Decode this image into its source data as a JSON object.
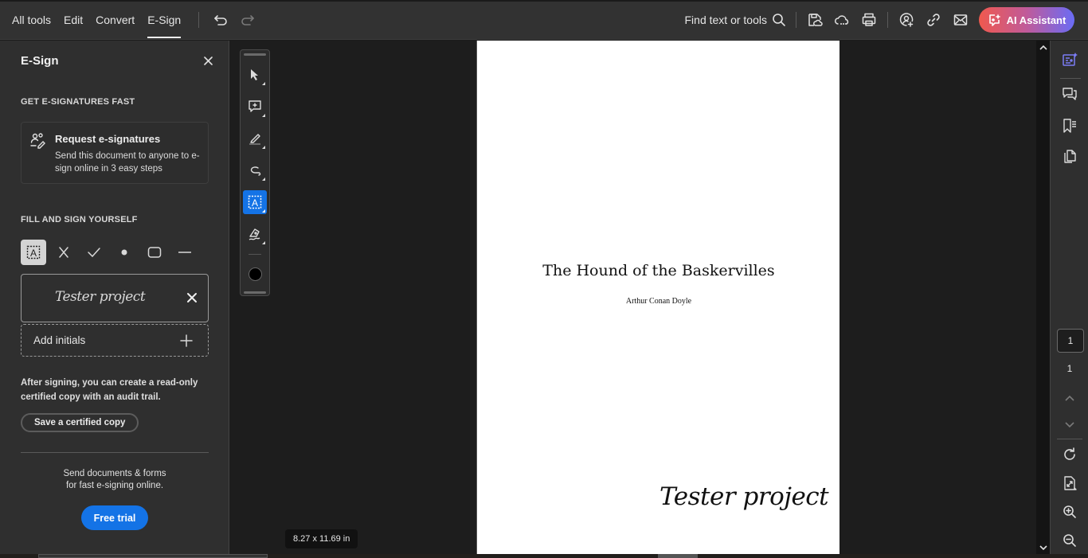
{
  "topbar": {
    "nav": [
      {
        "label": "All tools",
        "active": false
      },
      {
        "label": "Edit",
        "active": false
      },
      {
        "label": "Convert",
        "active": false
      },
      {
        "label": "E-Sign",
        "active": true
      }
    ],
    "find_label": "Find text or tools",
    "ai_assistant_label": "AI Assistant",
    "icons": [
      "undo-icon",
      "redo-icon",
      "search-icon",
      "save-icon",
      "cloud-icon",
      "print-icon",
      "share-user-icon",
      "link-icon",
      "email-icon"
    ]
  },
  "panel": {
    "title": "E-Sign",
    "section1_heading": "GET E-SIGNATURES FAST",
    "request": {
      "title": "Request e-signatures",
      "description": "Send this document to anyone to e-sign online in 3 easy steps"
    },
    "section2_heading": "FILL AND SIGN YOURSELF",
    "tools": [
      "text-field",
      "cross-mark",
      "check-mark",
      "dot",
      "rectangle",
      "line"
    ],
    "signature_text": "Tester project",
    "add_initials_label": "Add initials",
    "after_signing_text": "After signing, you can create a read-only certified copy with an audit trail.",
    "certified_copy_label": "Save a certified copy",
    "promo_line1": "Send documents & forms",
    "promo_line2": "for fast e-signing online.",
    "free_trial_label": "Free trial"
  },
  "document": {
    "title": "The Hound of the Baskervilles",
    "author": "Arthur Conan Doyle",
    "placed_signature": "Tester project",
    "page_size": "8.27 x 11.69 in"
  },
  "rightbar": {
    "current_page": "1",
    "total_pages": "1"
  },
  "colors": {
    "accent": "#1473e6",
    "ai_gradient_start": "#f0594e",
    "ai_gradient_end": "#6a6cf5",
    "panel_bg": "#2f2f2f",
    "canvas_bg": "#1d1d1d"
  }
}
